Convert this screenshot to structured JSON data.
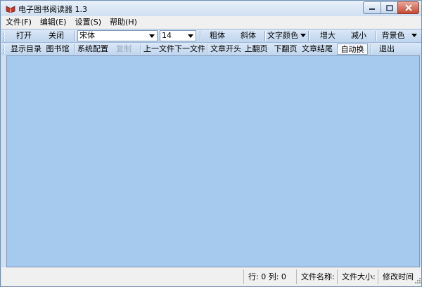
{
  "window": {
    "title": "电子图书阅读器 1.3"
  },
  "menu": [
    "文件(F)",
    "编辑(E)",
    "设置(S)",
    "帮助(H)"
  ],
  "toolbar1": {
    "open": "打开",
    "close": "关闭",
    "font_select": "宋体",
    "size_select": "14",
    "bold": "粗体",
    "italic": "斜体",
    "text_color": "文字颜色",
    "zoom_in": "增大",
    "zoom_out": "减小",
    "bg_color": "背景色"
  },
  "toolbar2": {
    "show_toc": "显示目录",
    "library": "图书馆",
    "settings": "系统配置",
    "copy": "复制",
    "prev_file": "上一文件",
    "next_file": "下一文件",
    "doc_start": "文章开头",
    "page_up": "上翻页",
    "page_down": "下翻页",
    "doc_end": "文章结尾",
    "auto_wrap": "自动换行",
    "exit": "退出"
  },
  "status": {
    "row_col": "行: 0  列: 0",
    "file_name": "文件名称:",
    "file_size": "文件大小:",
    "modified": "修改时间"
  },
  "colors": {
    "content_bg": "#a6c9ee",
    "toolbar": "#c8dbf1"
  }
}
